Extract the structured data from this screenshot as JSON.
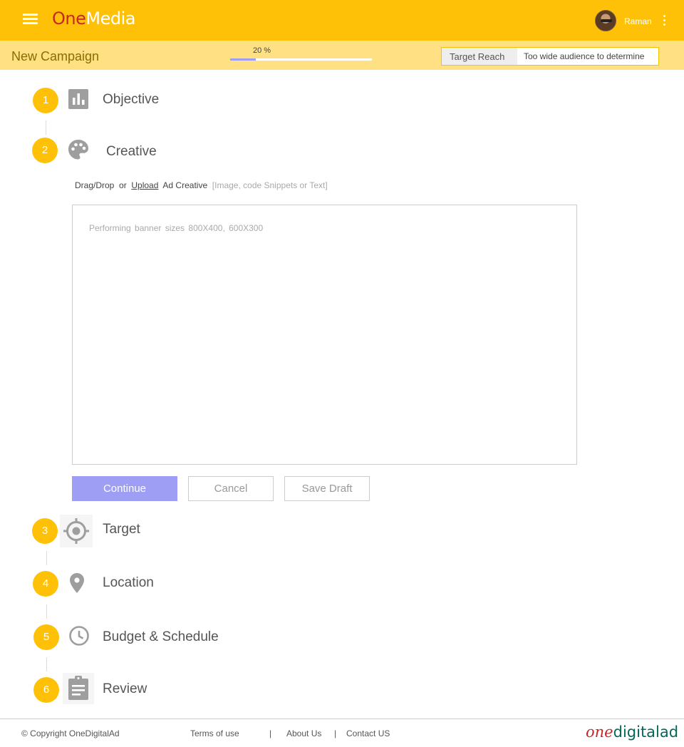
{
  "header": {
    "logo_part1": "One",
    "logo_part2": "Media",
    "user_name": "Raman",
    "icons": {
      "menu": "hamburger-icon",
      "more": "kebab-vertical-icon"
    },
    "colors": {
      "bar": "#ffc107",
      "logo_accent": "#c62828"
    }
  },
  "subheader": {
    "title": "New Campaign",
    "progress_label": "20 %",
    "progress_fraction": 0.18,
    "target_reach_label": "Target Reach",
    "target_reach_value": "Too wide audience to determine"
  },
  "steps": [
    {
      "number": "1",
      "title": "Objective",
      "icon": "bar-chart-icon"
    },
    {
      "number": "2",
      "title": "Creative",
      "icon": "palette-icon"
    },
    {
      "number": "3",
      "title": "Target",
      "icon": "crosshair-icon"
    },
    {
      "number": "4",
      "title": "Location",
      "icon": "map-pin-icon"
    },
    {
      "number": "5",
      "title": "Budget & Schedule",
      "icon": "clock-icon"
    },
    {
      "number": "6",
      "title": "Review",
      "icon": "clipboard-icon"
    }
  ],
  "creative": {
    "drag_text": "Drag/Drop",
    "or_text": "or",
    "upload_link": "Upload",
    "ad_creative_text": "Ad Creative",
    "hint": "[Image, code Snippets or Text]",
    "placeholder": "Performing banner sizes  800X400,  600X300",
    "buttons": {
      "continue": "Continue",
      "cancel": "Cancel",
      "save_draft": "Save Draft"
    },
    "accent_color": "#9e9ef5"
  },
  "footer": {
    "copyright": "© Copyright OneDigitalAd",
    "terms": "Terms of use",
    "separator": "|",
    "about": "About Us",
    "contact": "Contact US",
    "brand_part1": "one",
    "brand_part2": "digitalad"
  }
}
